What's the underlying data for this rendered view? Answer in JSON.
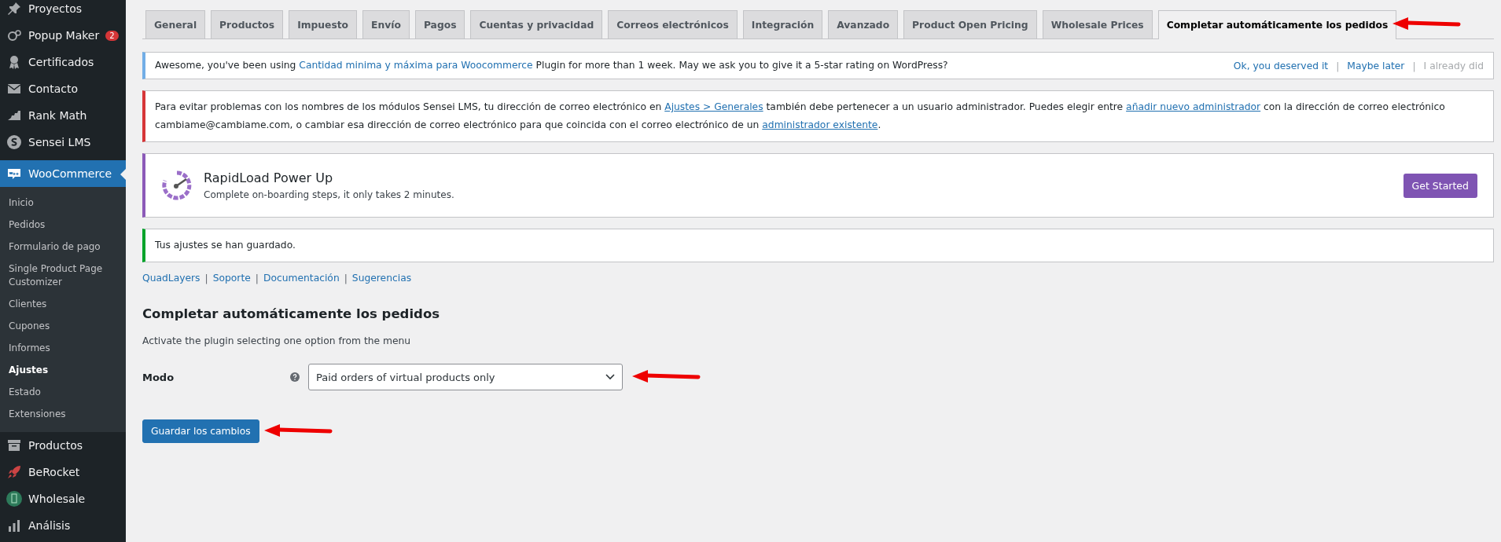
{
  "sidebar": {
    "items": [
      {
        "label": "Proyectos",
        "selected": false
      },
      {
        "label": "Popup Maker",
        "badge": "2",
        "selected": false
      },
      {
        "label": "Certificados",
        "selected": false
      },
      {
        "label": "Contacto",
        "selected": false
      },
      {
        "label": "Rank Math",
        "selected": false
      },
      {
        "label": "Sensei LMS",
        "selected": false
      },
      {
        "label": "WooCommerce",
        "selected": true,
        "children": [
          {
            "label": "Inicio",
            "selected": false
          },
          {
            "label": "Pedidos",
            "selected": false
          },
          {
            "label": "Formulario de pago",
            "selected": false
          },
          {
            "label": "Single Product Page Customizer",
            "selected": false
          },
          {
            "label": "Clientes",
            "selected": false
          },
          {
            "label": "Cupones",
            "selected": false
          },
          {
            "label": "Informes",
            "selected": false
          },
          {
            "label": "Ajustes",
            "selected": true
          },
          {
            "label": "Estado",
            "selected": false
          },
          {
            "label": "Extensiones",
            "selected": false
          }
        ]
      },
      {
        "label": "Productos",
        "selected": false
      },
      {
        "label": "BeRocket",
        "selected": false
      },
      {
        "label": "Wholesale",
        "selected": false
      },
      {
        "label": "Análisis",
        "selected": false
      }
    ]
  },
  "tabs": [
    {
      "label": "General",
      "selected": false
    },
    {
      "label": "Productos",
      "selected": false
    },
    {
      "label": "Impuesto",
      "selected": false
    },
    {
      "label": "Envío",
      "selected": false
    },
    {
      "label": "Pagos",
      "selected": false
    },
    {
      "label": "Cuentas y privacidad",
      "selected": false
    },
    {
      "label": "Correos electrónicos",
      "selected": false
    },
    {
      "label": "Integración",
      "selected": false
    },
    {
      "label": "Avanzado",
      "selected": false
    },
    {
      "label": "Product Open Pricing",
      "selected": false
    },
    {
      "label": "Wholesale Prices",
      "selected": false
    },
    {
      "label": "Completar automáticamente los pedidos",
      "selected": true
    }
  ],
  "notices": [
    {
      "kind": "info",
      "parts": [
        {
          "text": "Awesome, you've been using "
        },
        {
          "link": "Cantidad minima y máxima para Woocommerce"
        },
        {
          "text": " Plugin for more than 1 week. May we ask you to give it a 5-star rating on WordPress?"
        }
      ],
      "actions": [
        {
          "kind": "link",
          "label": "Ok, you deserved it",
          "disabled": false
        },
        {
          "kind": "separator",
          "label": "|"
        },
        {
          "kind": "link",
          "label": "Maybe later",
          "disabled": false
        },
        {
          "kind": "separator",
          "label": "|"
        },
        {
          "kind": "link",
          "label": "I already did",
          "disabled": true
        }
      ]
    },
    {
      "kind": "error",
      "parts": [
        {
          "text": "Para evitar problemas con los nombres de los módulos Sensei LMS, tu dirección de correo electrónico en "
        },
        {
          "link": "Ajustes > Generales"
        },
        {
          "text": " también debe pertenecer a un usuario administrador. Puedes elegir entre "
        },
        {
          "link": "añadir nuevo administrador"
        },
        {
          "text": " con la dirección de correo electrónico cambiame@cambiame.com, o cambiar esa dirección de correo electrónico para que coincida con el correo electrónico de un "
        },
        {
          "link": "administrador existente"
        },
        {
          "text": "."
        }
      ]
    },
    {
      "kind": "promo",
      "title": "RapidLoad Power Up",
      "subtitle": "Complete on-boarding steps, it only takes 2 minutes.",
      "button": "Get Started"
    },
    {
      "kind": "success",
      "parts": [
        {
          "text": "Tus ajustes se han guardado."
        }
      ]
    }
  ],
  "plugin_links": [
    {
      "kind": "link",
      "label": "QuadLayers"
    },
    {
      "kind": "separator",
      "label": "|"
    },
    {
      "kind": "link",
      "label": "Soporte"
    },
    {
      "kind": "separator",
      "label": "|"
    },
    {
      "kind": "link",
      "label": "Documentación"
    },
    {
      "kind": "separator",
      "label": "|"
    },
    {
      "kind": "link",
      "label": "Sugerencias"
    }
  ],
  "section": {
    "title": "Completar automáticamente los pedidos",
    "description": "Activate the plugin selecting one option from the menu"
  },
  "field": {
    "label": "Modo",
    "value": "Paid orders of virtual products only"
  },
  "save_button": "Guardar los cambios"
}
